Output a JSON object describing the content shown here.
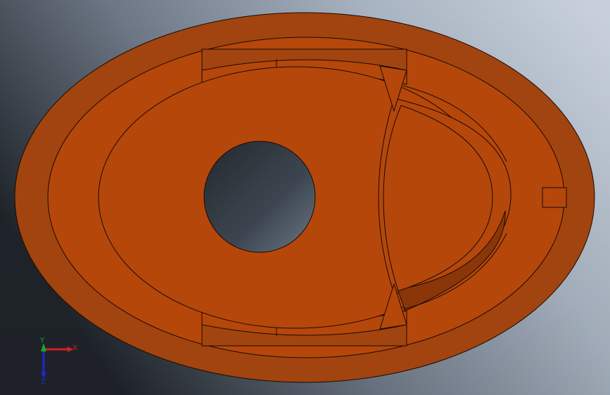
{
  "viewport": {
    "background_dark": "#2a2f35",
    "background_light": "#c9d1db",
    "background_mid": "#6f7d8c"
  },
  "part": {
    "face_color": "#b5470b",
    "face_color_dark": "#a2440f",
    "wall_shadow_color": "#8a3608",
    "edge_color": "#1a0a02"
  },
  "triad": {
    "x_label": "X",
    "y_label": "Y",
    "z_label": "Z",
    "x_color": "#d32020",
    "y_color": "#1aa81a",
    "z_color": "#1a2ad0"
  }
}
